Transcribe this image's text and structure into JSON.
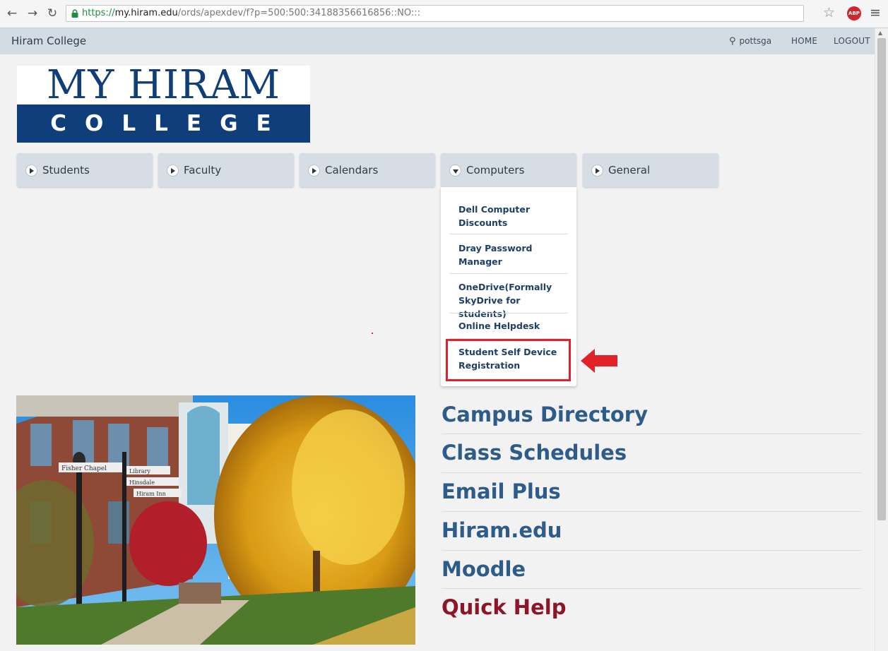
{
  "browser": {
    "url_scheme": "https://",
    "url_host": "my.hiram.edu",
    "url_path": "/ords/apexdev/f?p=500:500:34188356616856::NO:::"
  },
  "appbar": {
    "brand": "Hiram College",
    "username": "pottsga",
    "home": "HOME",
    "logout": "LOGOUT"
  },
  "logo": {
    "line1": "MY HIRAM",
    "line2": "COLLEGE"
  },
  "tabs": [
    {
      "label": "Students"
    },
    {
      "label": "Faculty"
    },
    {
      "label": "Calendars"
    },
    {
      "label": "Computers"
    },
    {
      "label": "General"
    }
  ],
  "dropdown": {
    "items": [
      {
        "label": "Dell Computer Discounts"
      },
      {
        "label": "Dray Password Manager"
      },
      {
        "label": "OneDrive(Formally SkyDrive for students)"
      },
      {
        "label": "Online Helpdesk"
      },
      {
        "label": "Student Self Device Registration"
      }
    ]
  },
  "photo": {
    "sign1": "Fisher Chapel",
    "sign2": "Library",
    "sign3": "Hinsdale",
    "sign4": "Hiram Inn"
  },
  "links": [
    {
      "label": "Campus Directory"
    },
    {
      "label": "Class Schedules"
    },
    {
      "label": "Email Plus"
    },
    {
      "label": "Hiram.edu"
    },
    {
      "label": "Moodle"
    },
    {
      "label": "Quick Help"
    }
  ],
  "colors": {
    "link_blue": "#2e5c8a",
    "link_red": "#8e1528",
    "logo_blue": "#0f3e7b",
    "annotation_red": "#e2222b"
  }
}
